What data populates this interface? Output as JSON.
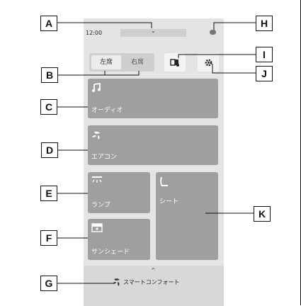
{
  "status": {
    "time": "12:00"
  },
  "seat_toggle": {
    "left": "左席",
    "right": "右席"
  },
  "tiles": {
    "audio": "オーディオ",
    "aircon": "エアコン",
    "lamp": "ランプ",
    "seat": "シート",
    "sunshade": "サンシェード"
  },
  "bottom_bar": {
    "caret": "^",
    "label": "スマートコンフォート"
  },
  "callouts": {
    "A": "A",
    "B": "B",
    "C": "C",
    "D": "D",
    "E": "E",
    "F": "F",
    "G": "G",
    "H": "H",
    "I": "I",
    "J": "J",
    "K": "K"
  },
  "icons": [
    "music-note-icon",
    "fan-icon",
    "lamp-icon",
    "seat-icon",
    "sunshade-icon",
    "manual-icon",
    "gear-icon",
    "comfort-icon"
  ],
  "colors": {
    "screen": "#e4e4e4",
    "tile": "#9f9f9f",
    "bottom_bar": "#d8d8d8"
  }
}
